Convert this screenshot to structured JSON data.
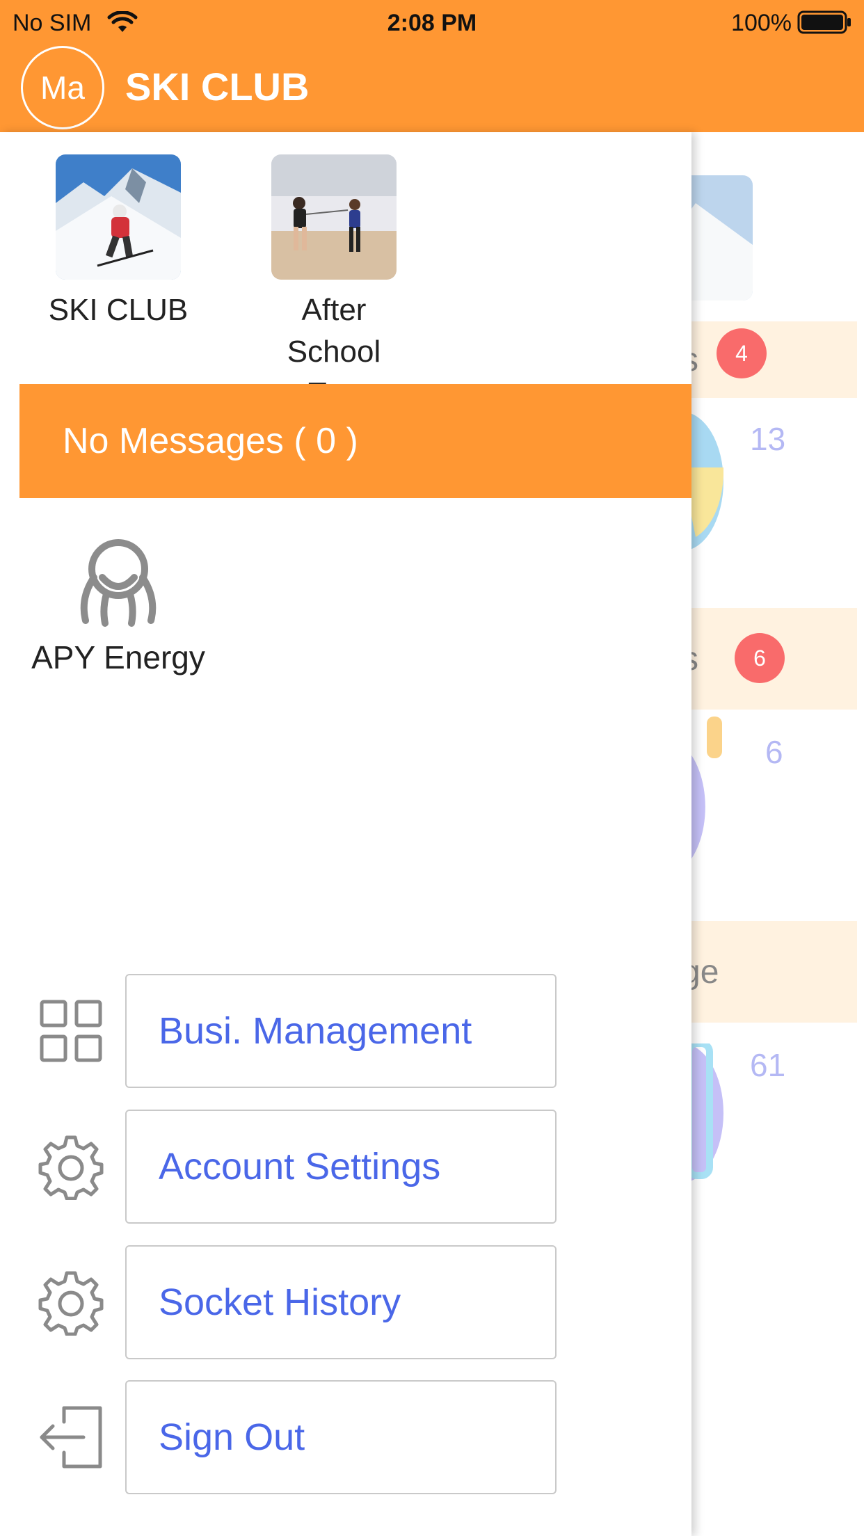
{
  "status_bar": {
    "carrier": "No SIM",
    "time": "2:08 PM",
    "battery": "100%"
  },
  "header": {
    "avatar_initials": "Ma",
    "title": "SKI CLUB"
  },
  "drawer": {
    "clubs": [
      {
        "label": "SKI CLUB",
        "thumb": "ski-photo"
      },
      {
        "label_line1": "After",
        "label_line2": "School Tr...",
        "thumb": "fencing-photo"
      }
    ],
    "messages_label": "No Messages ( 0 )",
    "partner": {
      "label": "APY Energy",
      "icon": "apy-energy-logo-icon"
    },
    "menu": [
      {
        "label": "Busi. Management",
        "icon": "grid-icon"
      },
      {
        "label": "Account Settings",
        "icon": "gear-icon"
      },
      {
        "label": "Socket History",
        "icon": "gear-icon"
      },
      {
        "label": "Sign Out",
        "icon": "sign-out-icon"
      }
    ]
  },
  "background": {
    "sections": [
      {
        "header_text": "s",
        "badge": "4",
        "number": "13"
      },
      {
        "header_text": "s",
        "badge": "6",
        "number": "6"
      },
      {
        "header_text": "ge",
        "number": "61"
      }
    ]
  },
  "colors": {
    "accent": "#FF9733",
    "link": "#4A67E8",
    "badge": "#F96B6B",
    "section_header_bg": "#FFF2E0"
  }
}
